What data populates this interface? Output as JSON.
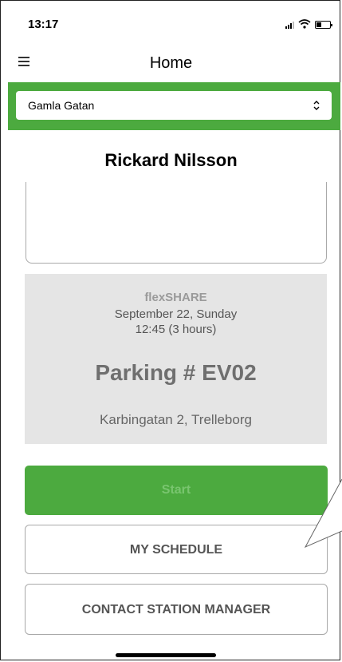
{
  "status_bar": {
    "time": "13:17"
  },
  "nav": {
    "title": "Home",
    "menu_icon": "hamburger-menu-icon"
  },
  "location_select": {
    "selected": "Gamla Gatan"
  },
  "user": {
    "name": "Rickard Nilsson"
  },
  "booking": {
    "provider": "flexSHARE",
    "date": "September 22, Sunday",
    "time": "12:45 (3 hours)",
    "parking": "Parking # EV02",
    "address": "Karbingatan 2, Trelleborg"
  },
  "actions": {
    "start_label": "Start",
    "schedule_label": "MY SCHEDULE",
    "contact_label": "CONTACT STATION MANAGER"
  },
  "colors": {
    "accent": "#4caa3f",
    "card_bg": "#e5e5e5"
  }
}
